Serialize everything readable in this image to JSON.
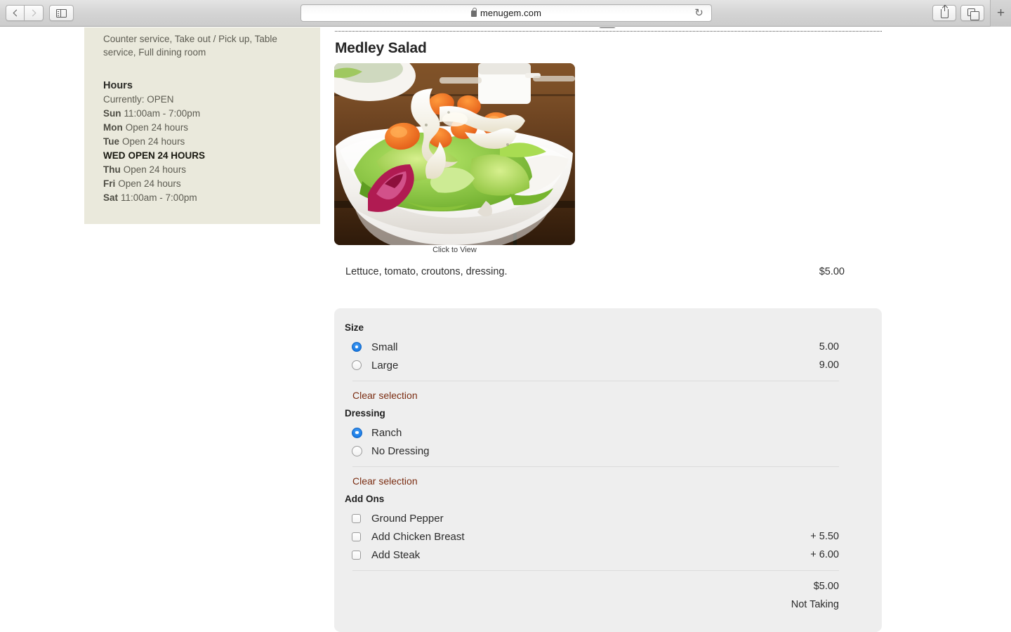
{
  "browser": {
    "back_icon": "chevron-left-icon",
    "forward_icon": "chevron-right-icon",
    "sidebar_icon": "sidebar-toggle-icon",
    "lock_icon": "lock-icon",
    "url": "menugem.com",
    "reload_icon": "reload-icon",
    "reload_glyph": "↻",
    "share_icon": "share-icon",
    "tabs_icon": "show-tabs-icon",
    "new_tab_label": "+"
  },
  "sidebar": {
    "service_types": "Counter service, Take out / Pick up, Table service, Full dining room",
    "hours_heading": "Hours",
    "currently": "Currently: OPEN",
    "hours": [
      {
        "day": "Sun",
        "hours": "11:00am - 7:00pm",
        "today": false
      },
      {
        "day": "Mon",
        "hours": "Open 24 hours",
        "today": false
      },
      {
        "day": "Tue",
        "hours": "Open 24 hours",
        "today": false
      },
      {
        "day": "WED",
        "hours": "OPEN 24 HOURS",
        "today": true
      },
      {
        "day": "Thu",
        "hours": "Open 24 hours",
        "today": false
      },
      {
        "day": "Fri",
        "hours": "Open 24 hours",
        "today": false
      },
      {
        "day": "Sat",
        "hours": "11:00am - 7:00pm",
        "today": false
      }
    ]
  },
  "item": {
    "title": "Medley Salad",
    "photo_alt": "salad-photo",
    "photo_caption": "Click to View",
    "description": "Lettuce, tomato, croutons, dressing.",
    "price": "$5.00"
  },
  "options": {
    "groups": [
      {
        "heading": "Size",
        "control_type": "radio",
        "size": "sm",
        "items": [
          {
            "label": "Small",
            "price": "5.00",
            "checked": true
          },
          {
            "label": "Large",
            "price": "9.00",
            "checked": false
          }
        ],
        "clear_label": "Clear selection"
      },
      {
        "heading": "Dressing",
        "control_type": "radio",
        "size": "lg",
        "items": [
          {
            "label": "Ranch",
            "price": "",
            "checked": true
          },
          {
            "label": "No Dressing",
            "price": "",
            "checked": false
          }
        ],
        "clear_label": "Clear selection"
      },
      {
        "heading": "Add Ons",
        "control_type": "checkbox",
        "size": "sm",
        "items": [
          {
            "label": "Ground Pepper",
            "price": "",
            "checked": false
          },
          {
            "label": "Add Chicken Breast",
            "price": "+ 5.50",
            "checked": false
          },
          {
            "label": "Add Steak",
            "price": "+ 6.00",
            "checked": false
          }
        ],
        "clear_label": ""
      }
    ],
    "total_price": "$5.00",
    "order_status": "Not Taking"
  },
  "colors": {
    "sidebar_bg": "#eae9dc",
    "panel_bg": "#eeeeee",
    "radio_accent": "#1779e4",
    "link_accent": "#7b2d12"
  }
}
